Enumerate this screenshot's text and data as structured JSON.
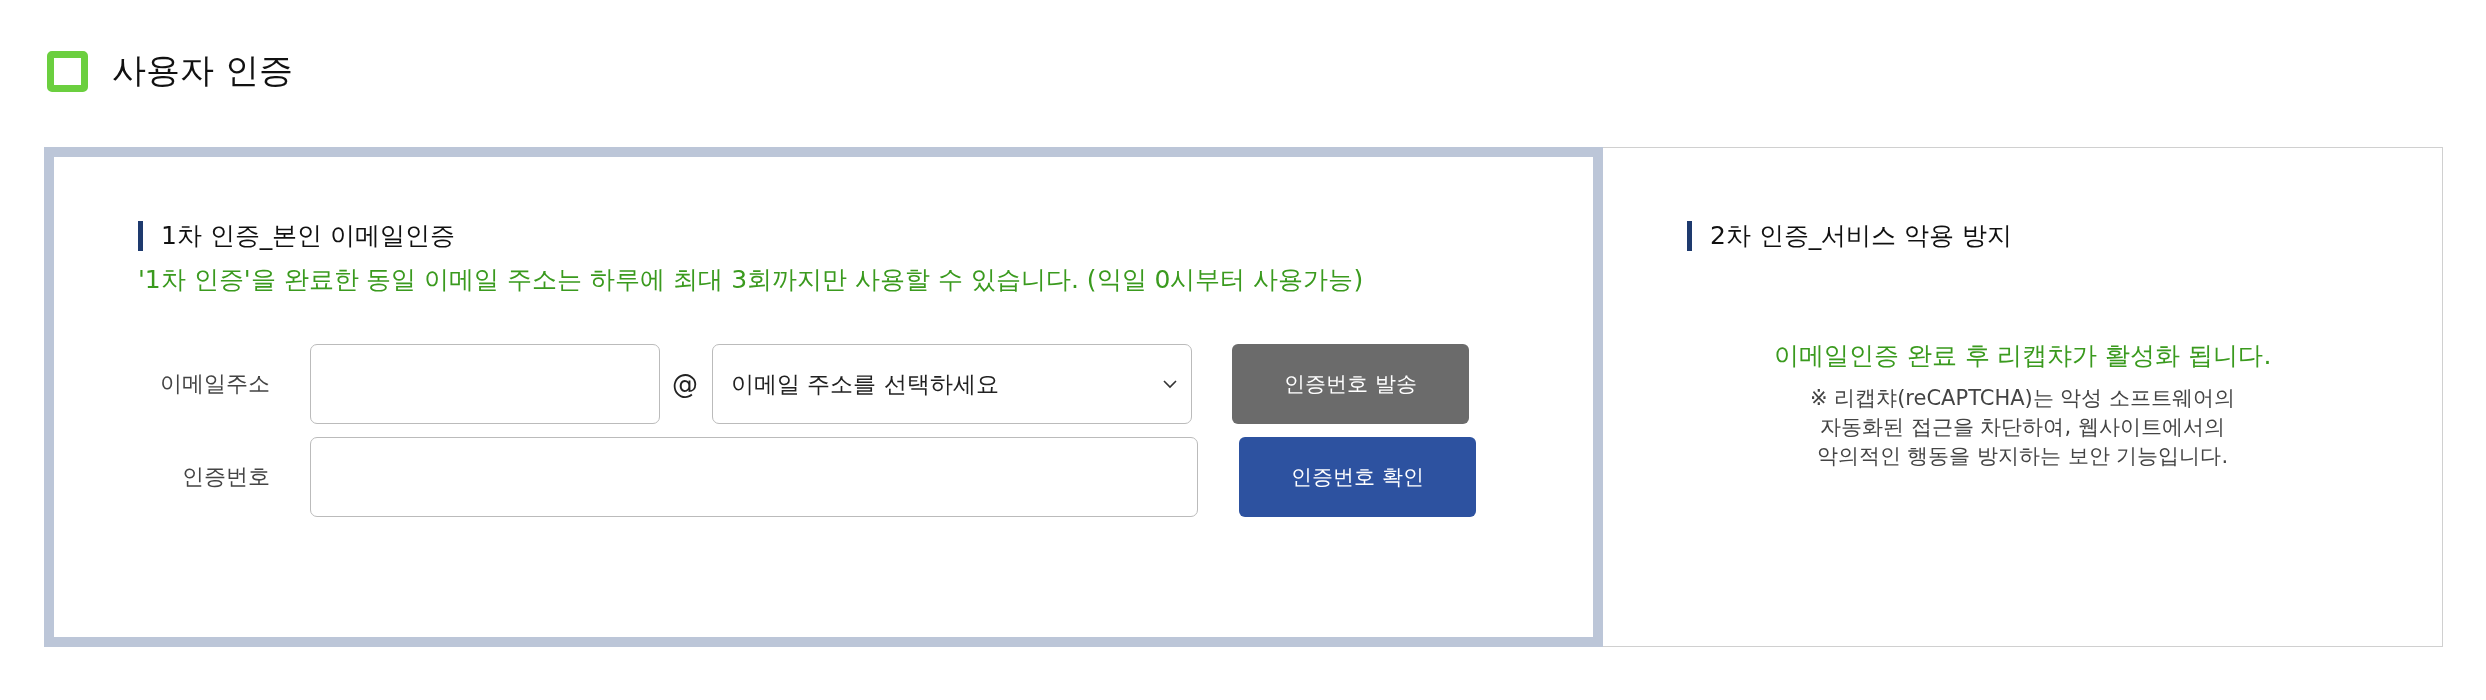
{
  "page_title": "사용자 인증",
  "steps": [
    {
      "kind": "form",
      "active": true,
      "heading": "1차 인증_본인 이메일인증",
      "notice": "'1차 인증'을 완료한 동일 이메일 주소는 하루에 최대 3회까지만 사용할 수 있습니다. (익일 0시부터 사용가능)",
      "email": {
        "label": "이메일주소",
        "at": "@",
        "domain_select": "이메일 주소를 선택하세요",
        "button": "인증번호 발송",
        "button_disabled": true
      },
      "code": {
        "label": "인증번호",
        "button": "인증번호 확인",
        "button_disabled": false
      }
    },
    {
      "kind": "info",
      "active": false,
      "heading": "2차 인증_서비스 악용 방지",
      "notice": "이메일인증 완료 후 리캡챠가 활성화 됩니다.",
      "description": "※ 리캡챠(reCAPTCHA)는 악성 소프트웨어의\n자동화된 접근을 차단하여, 웹사이트에서의\n악의적인 행동을 방지하는 보안 기능입니다."
    }
  ]
}
